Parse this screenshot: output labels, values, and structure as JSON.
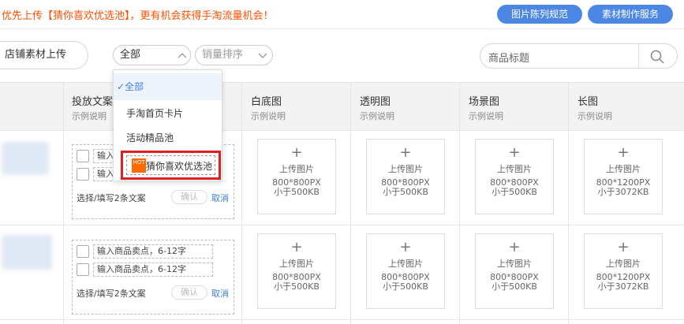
{
  "notice": {
    "text": "优先上传【猜你喜欢优选池】，更有机会获得手淘流量机会！"
  },
  "top_buttons": {
    "spec": "图片陈列规范",
    "service": "素材制作服务"
  },
  "toolbar": {
    "store_upload": "店铺素材上传",
    "scope_select": "全部",
    "sort_select": "销量排序",
    "search_placeholder": "商品标题"
  },
  "dropdown": {
    "items": [
      "全部",
      "手淘首页卡片",
      "活动精品池",
      "猜你喜欢优选池"
    ],
    "selected": "全部",
    "hot_badge": "HOT"
  },
  "columns": [
    {
      "title": "投放文案",
      "sub": "示例说明"
    },
    {
      "title": "白底图",
      "sub": "示例说明"
    },
    {
      "title": "透明图",
      "sub": "示例说明"
    },
    {
      "title": "场景图",
      "sub": "示例说明"
    },
    {
      "title": "长图",
      "sub": "示例说明"
    }
  ],
  "copy": {
    "input_placeholder": "输入商品卖点，6-12字",
    "input_short": "输入",
    "hint": "选择/填写2条文案",
    "confirm": "确认",
    "cancel": "取消"
  },
  "upload": {
    "plus": "+",
    "label": "上传图片",
    "square_size": "800*800PX",
    "square_limit": "小于500KB",
    "long_size": "800*1200PX",
    "long_limit": "小于3072KB"
  },
  "colors": {
    "accent": "#4d87e6",
    "notice": "#ff5000",
    "highlight": "#e02020",
    "link": "#3d7ee6"
  }
}
